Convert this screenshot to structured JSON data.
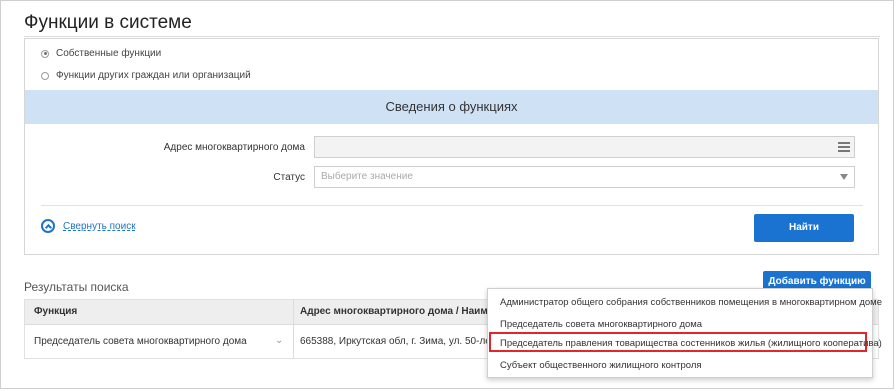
{
  "page": {
    "title": "Функции в системе"
  },
  "search": {
    "radio_own": "Собственные функции",
    "radio_others": "Функции других граждан или организаций",
    "section_title": "Сведения о функциях",
    "address_label": "Адрес многоквартирного дома",
    "status_label": "Статус",
    "status_placeholder": "Выберите значение",
    "collapse_label": "Свернуть поиск",
    "find_button": "Найти"
  },
  "results": {
    "title": "Результаты поиска",
    "add_button": "Добавить функцию",
    "columns": [
      "Функция",
      "Адрес многоквартирного дома / Наименова"
    ],
    "rows": [
      {
        "function": "Председатель совета многоквартирного дома",
        "address": "665388, Иркутская обл, г. Зима, ул. 50-летия П"
      }
    ]
  },
  "menu": {
    "items": [
      "Администратор общего собрания собственников помещения в многоквартирном доме",
      "Председатель совета многоквартирного дома",
      "Председатель правления товарищества состенников жилья (жилищного кооператива)",
      "Субъект общественного жилищного контроля"
    ],
    "highlighted_index": 2
  },
  "colors": {
    "accent": "#1a73d1",
    "band": "#cfe2f5",
    "highlight": "#e2262b"
  }
}
